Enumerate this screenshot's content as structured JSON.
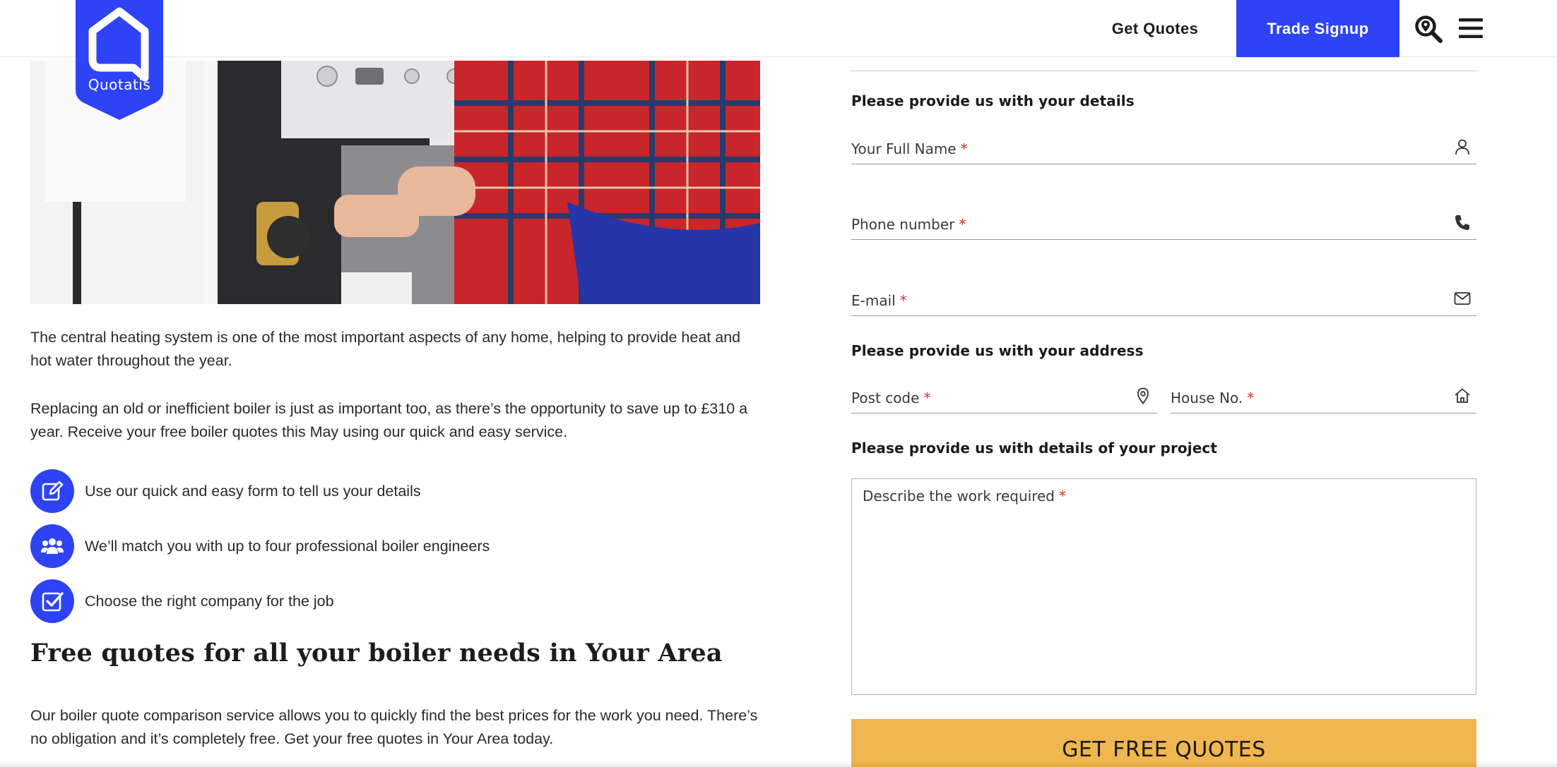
{
  "header": {
    "logo_text": "Quotatis",
    "nav": {
      "get_quotes": "Get Quotes",
      "trade_signup": "Trade Signup"
    },
    "icons": {
      "search": "search-location-icon",
      "menu": "hamburger-menu-icon"
    }
  },
  "colors": {
    "brand_blue": "#2d43f5",
    "cta_orange": "#f0b64f",
    "required_red": "#d0312d"
  },
  "main": {
    "intro_1": "The central heating system is one of the most important aspects of any home, helping to provide heat and hot water throughout the year.",
    "intro_2": "Replacing an old or inefficient boiler is just as important too, as there’s the opportunity to save up to £310 a year. Receive your free boiler quotes this May using our quick and easy service.",
    "steps": [
      {
        "label": "Use our quick and easy form to tell us your details",
        "icon": "edit-icon"
      },
      {
        "label": "We’ll match you with up to four professional boiler engineers",
        "icon": "users-icon"
      },
      {
        "label": "Choose the right company for the job",
        "icon": "checkbox-icon"
      }
    ],
    "heading": "Free quotes for all your boiler needs in Your Area",
    "outro": "Our boiler quote comparison service allows you to quickly find the best prices for the work you need. There’s no obligation and it’s completely free. Get your free quotes in Your Area today."
  },
  "form": {
    "details_title": "Please provide us with your details",
    "name_placeholder": "Your Full Name",
    "phone_placeholder": "Phone number",
    "email_placeholder": "E-mail",
    "address_title": "Please provide us with your address",
    "postcode_placeholder": "Post code",
    "house_placeholder": "House No.",
    "project_title": "Please provide us with details of your project",
    "description_placeholder": "Describe the work required",
    "required_mark": "*",
    "submit_label": "GET FREE QUOTES"
  }
}
